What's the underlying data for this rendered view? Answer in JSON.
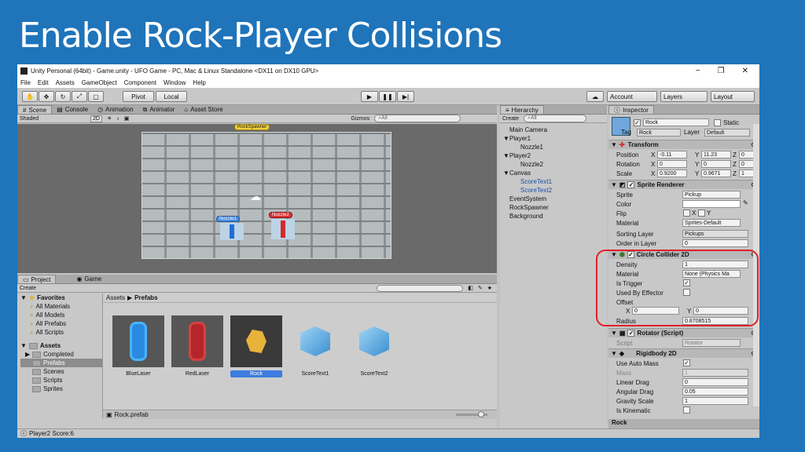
{
  "slide_title": "Enable Rock-Player Collisions",
  "window": {
    "title": "Unity Personal (64bit) - Game.unity - UFO Game - PC, Mac & Linux Standalone <DX11 on DX10 GPU>",
    "controls": [
      "−",
      "❐",
      "✕"
    ]
  },
  "menu": [
    "File",
    "Edit",
    "Assets",
    "GameObject",
    "Component",
    "Window",
    "Help"
  ],
  "toolbar": {
    "pivot": "Pivot",
    "local": "Local",
    "account": "Account",
    "layers": "Layers",
    "layout": "Layout"
  },
  "scene": {
    "tabs": [
      "Scene",
      "Console",
      "Animation",
      "Animator",
      "Asset Store"
    ],
    "shading": "Shaded",
    "mode_2d": "2D",
    "gizmos": "Gizmos",
    "search_placeholder": "All",
    "spawner_label": "RockSpawner",
    "nozzle1_label": "Nozzle1",
    "nozzle2_label": "Nozzle2"
  },
  "hierarchy": {
    "tab": "Hierarchy",
    "create": "Create",
    "search_placeholder": "All",
    "items": [
      {
        "label": "Main Camera",
        "indent": 0,
        "arrow": "",
        "blue": false
      },
      {
        "label": "Player1",
        "indent": 0,
        "arrow": "▼",
        "blue": false
      },
      {
        "label": "Nozzle1",
        "indent": 1,
        "arrow": "",
        "blue": false
      },
      {
        "label": "Player2",
        "indent": 0,
        "arrow": "▼",
        "blue": false
      },
      {
        "label": "Nozzle2",
        "indent": 1,
        "arrow": "",
        "blue": false
      },
      {
        "label": "Canvas",
        "indent": 0,
        "arrow": "▼",
        "blue": false
      },
      {
        "label": "ScoreText1",
        "indent": 1,
        "arrow": "",
        "blue": true
      },
      {
        "label": "ScoreText2",
        "indent": 1,
        "arrow": "",
        "blue": true
      },
      {
        "label": "EventSystem",
        "indent": 0,
        "arrow": "",
        "blue": false
      },
      {
        "label": "RockSpawner",
        "indent": 0,
        "arrow": "",
        "blue": false
      },
      {
        "label": "Background",
        "indent": 0,
        "arrow": "",
        "blue": false
      }
    ]
  },
  "inspector": {
    "tab": "Inspector",
    "object_name": "Rock",
    "static": "Static",
    "tag_label": "Tag",
    "tag_value": "Rock",
    "layer_label": "Layer",
    "layer_value": "Default",
    "transform": {
      "title": "Transform",
      "position_label": "Position",
      "rotation_label": "Rotation",
      "scale_label": "Scale",
      "position": [
        "-0.11",
        "11.23",
        "0"
      ],
      "rotation": [
        "0",
        "0",
        "0"
      ],
      "scale": [
        "0.9200",
        "0.9671",
        "1"
      ],
      "axes": [
        "X",
        "Y",
        "Z"
      ]
    },
    "sprite_renderer": {
      "title": "Sprite Renderer",
      "sprite_label": "Sprite",
      "sprite_value": "Pickup",
      "color_label": "Color",
      "flip_label": "Flip",
      "flip_x": "X",
      "flip_y": "Y",
      "material_label": "Material",
      "material_value": "Sprites-Default",
      "sorting_layer_label": "Sorting Layer",
      "sorting_layer_value": "Pickups",
      "order_label": "Order in Layer",
      "order_value": "0"
    },
    "circle_collider": {
      "title": "Circle Collider 2D",
      "density_label": "Density",
      "density_value": "1",
      "material_label": "Material",
      "material_value": "None (Physics Ma",
      "is_trigger_label": "Is Trigger",
      "is_trigger_checked": true,
      "effector_label": "Used By Effector",
      "offset_label": "Offset",
      "offset_x": "0",
      "offset_y": "0",
      "radius_label": "Radius",
      "radius_value": "0.8708515"
    },
    "rotator": {
      "title": "Rotator (Script)",
      "script_label": "Script",
      "script_value": "Rotator"
    },
    "rigidbody": {
      "title": "Rigidbody 2D",
      "auto_mass_label": "Use Auto Mass",
      "mass_label": "Mass",
      "mass_value": "1",
      "linear_drag_label": "Linear Drag",
      "linear_drag_value": "0",
      "angular_drag_label": "Angular Drag",
      "angular_drag_value": "0.05",
      "gravity_label": "Gravity Scale",
      "gravity_value": "1",
      "kinematic_label": "Is Kinematic"
    },
    "footer": "Rock"
  },
  "project": {
    "tabs": [
      "Project",
      "Game"
    ],
    "create": "Create",
    "favorites_label": "Favorites",
    "favorites": [
      "All Materials",
      "All Models",
      "All Prefabs",
      "All Scripts"
    ],
    "assets_label": "Assets",
    "folders": [
      "Completed",
      "Prefabs",
      "Scenes",
      "Scripts",
      "Sprites"
    ],
    "breadcrumb_root": "Assets",
    "breadcrumb_sep": "▶",
    "breadcrumb_current": "Prefabs",
    "assets": [
      {
        "name": "BlueLaser",
        "kind": "blue"
      },
      {
        "name": "RedLaser",
        "kind": "red"
      },
      {
        "name": "Rock",
        "kind": "rock"
      },
      {
        "name": "ScoreText1",
        "kind": "cube"
      },
      {
        "name": "ScoreText2",
        "kind": "cube"
      }
    ],
    "selected_file": "Rock.prefab"
  },
  "status": "Player2 Score:6",
  "colors": {
    "highlight": "#e0202a",
    "selection": "#3d7de0",
    "slide_bg": "#1f74ba"
  }
}
